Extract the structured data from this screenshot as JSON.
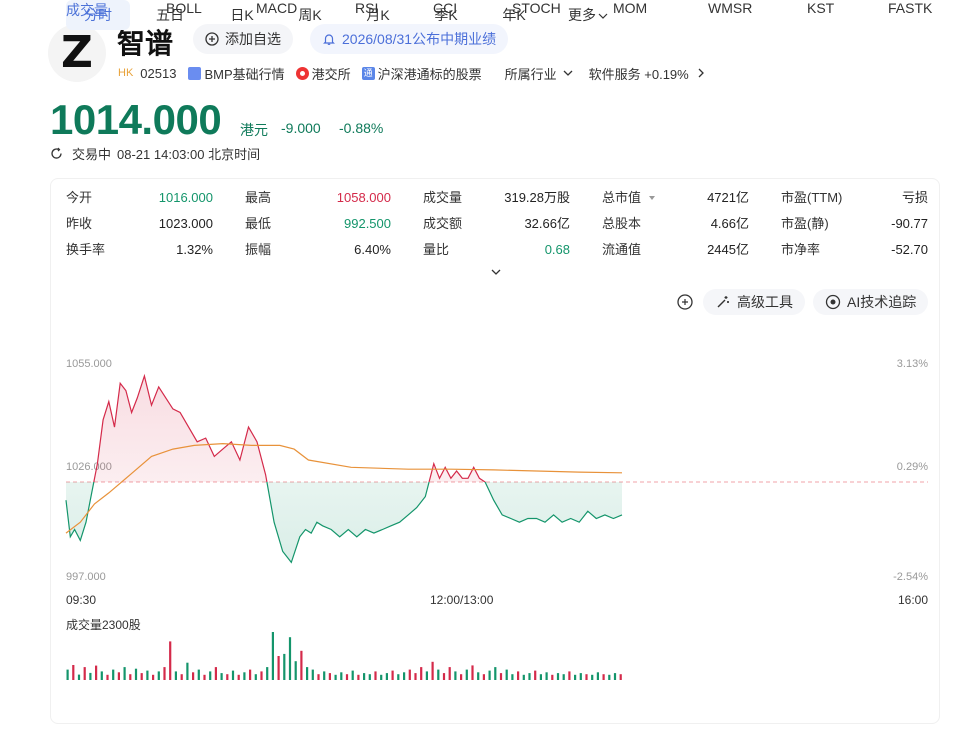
{
  "stock": {
    "logo_letter": "Z",
    "name": "智谱",
    "watch_label": "添加自选",
    "notice_label": "2026/08/31公布中期业绩"
  },
  "meta": {
    "market": "HK",
    "code": "02513",
    "bmp_label": "BMP基础行情",
    "exchange_label": "港交所",
    "connect_badge": "通",
    "connect_label": "沪深港通标的股票",
    "industry_label": "所属行业",
    "sector_label": "软件服务 +0.19%"
  },
  "quote": {
    "price": "1014.000",
    "currency": "港元",
    "change": "-9.000",
    "change_pct": "-0.88%",
    "status": "交易中",
    "time": "08-21 14:03:00 北京时间"
  },
  "stats": [
    {
      "label": "今开",
      "value": "1016.000",
      "color": "green"
    },
    {
      "label": "最高",
      "value": "1058.000",
      "color": "red"
    },
    {
      "label": "成交量",
      "value": "319.28万股",
      "color": "normal"
    },
    {
      "label": "总市值",
      "value": "4721亿",
      "color": "normal"
    },
    {
      "label": "市盈(TTM)",
      "value": "亏损",
      "color": "normal"
    },
    {
      "label": "昨收",
      "value": "1023.000",
      "color": "normal"
    },
    {
      "label": "最低",
      "value": "992.500",
      "color": "green"
    },
    {
      "label": "成交额",
      "value": "32.66亿",
      "color": "normal"
    },
    {
      "label": "总股本",
      "value": "4.66亿",
      "color": "normal"
    },
    {
      "label": "市盈(静)",
      "value": "-90.77",
      "color": "normal"
    },
    {
      "label": "换手率",
      "value": "1.32%",
      "color": "normal"
    },
    {
      "label": "振幅",
      "value": "6.40%",
      "color": "normal"
    },
    {
      "label": "量比",
      "value": "0.68",
      "color": "green"
    },
    {
      "label": "流通值",
      "value": "2445亿",
      "color": "normal"
    },
    {
      "label": "市净率",
      "value": "-52.70",
      "color": "normal"
    }
  ],
  "period_tabs": [
    "分时",
    "五日",
    "日K",
    "周K",
    "月K",
    "季K",
    "年K",
    "更多"
  ],
  "active_period": "分时",
  "tools": {
    "advanced": "高级工具",
    "ai": "AI技术追踪"
  },
  "chart_axes": {
    "y_top": "1055.000",
    "y_mid": "1026.000",
    "y_bottom": "997.000",
    "pct_top": "3.13%",
    "pct_mid": "0.29%",
    "pct_bottom": "-2.54%",
    "t_start": "09:30",
    "t_mid": "12:00/13:00",
    "t_end": "16:00"
  },
  "volume_title": "成交量2300股",
  "indicator_tabs": [
    "成交量",
    "BOLL",
    "MACD",
    "RSI",
    "CCI",
    "STOCH",
    "MOM",
    "WMSR",
    "KST",
    "FASTK"
  ],
  "active_indicator": "成交量",
  "colors": {
    "up": "#d42a4a",
    "down": "#14956b",
    "avg_line": "#e8923a",
    "accent": "#4c72d8"
  },
  "chart_data": {
    "type": "line",
    "title": "",
    "xlabel": "",
    "ylabel": "",
    "prev_close": 1023.0,
    "ylim": [
      997,
      1055
    ],
    "x_ticks": [
      "09:30",
      "12:00/13:00",
      "16:00"
    ],
    "x_range_minutes": [
      0,
      390
    ],
    "series": [
      {
        "name": "",
        "kind": "price",
        "x": [
          0,
          3,
          6,
          10,
          14,
          18,
          22,
          26,
          30,
          34,
          38,
          42,
          46,
          50,
          55,
          60,
          65,
          70,
          75,
          80,
          86,
          92,
          98,
          104,
          110,
          116,
          122,
          128,
          134,
          140,
          146,
          152,
          158,
          164,
          168,
          172,
          176,
          180,
          186,
          192,
          198,
          204,
          210,
          216,
          222,
          228,
          234,
          240,
          246,
          252,
          258,
          262,
          266,
          270,
          274,
          278,
          282,
          286,
          290,
          294,
          300,
          306,
          312,
          318,
          324,
          330,
          336,
          342,
          348,
          354,
          360,
          366,
          372,
          378,
          384,
          390
        ],
        "values": [
          1018,
          1008,
          1010,
          1007,
          1012,
          1020,
          1028,
          1040,
          1045,
          1038,
          1050,
          1048,
          1042,
          1046,
          1052,
          1044,
          1049,
          1046,
          1043,
          1042,
          1038,
          1034,
          1035,
          1030,
          1032,
          1034,
          1029,
          1038,
          1034,
          1025,
          1012,
          1004,
          1001,
          1008,
          1010,
          1009,
          1012,
          1011,
          1010,
          1008,
          1010,
          1008,
          1010,
          1009,
          1010,
          1011,
          1012,
          1014,
          1016,
          1019,
          1028,
          1024,
          1027,
          1024,
          1026,
          1024,
          1024,
          1027,
          1024,
          1023,
          1018,
          1014,
          1013,
          1012,
          1013,
          1013,
          1012,
          1014,
          1012,
          1013,
          1012,
          1015,
          1013,
          1014,
          1013,
          1014
        ]
      },
      {
        "name": "",
        "kind": "average",
        "x": [
          0,
          10,
          20,
          30,
          45,
          60,
          75,
          90,
          110,
          130,
          150,
          160,
          170,
          200,
          240,
          270,
          300,
          330,
          360,
          390
        ],
        "values": [
          1009,
          1012,
          1017,
          1020,
          1025,
          1030,
          1032,
          1033,
          1033.5,
          1033,
          1033,
          1032,
          1029,
          1027,
          1026.5,
          1026.5,
          1026.3,
          1026,
          1025.7,
          1025.5
        ]
      }
    ],
    "volume": {
      "name": "成交量",
      "max": 2300,
      "bars": [
        {
          "x": 0,
          "v": 500,
          "up": false
        },
        {
          "x": 4,
          "v": 720,
          "up": true
        },
        {
          "x": 8,
          "v": 260,
          "up": false
        },
        {
          "x": 12,
          "v": 620,
          "up": true
        },
        {
          "x": 16,
          "v": 340,
          "up": false
        },
        {
          "x": 20,
          "v": 690,
          "up": true
        },
        {
          "x": 24,
          "v": 410,
          "up": false
        },
        {
          "x": 28,
          "v": 250,
          "up": true
        },
        {
          "x": 32,
          "v": 500,
          "up": false
        },
        {
          "x": 36,
          "v": 370,
          "up": true
        },
        {
          "x": 40,
          "v": 620,
          "up": false
        },
        {
          "x": 44,
          "v": 280,
          "up": true
        },
        {
          "x": 48,
          "v": 540,
          "up": false
        },
        {
          "x": 52,
          "v": 330,
          "up": true
        },
        {
          "x": 56,
          "v": 450,
          "up": false
        },
        {
          "x": 60,
          "v": 250,
          "up": true
        },
        {
          "x": 64,
          "v": 410,
          "up": false
        },
        {
          "x": 68,
          "v": 620,
          "up": true
        },
        {
          "x": 72,
          "v": 1850,
          "up": true
        },
        {
          "x": 76,
          "v": 410,
          "up": false
        },
        {
          "x": 80,
          "v": 280,
          "up": true
        },
        {
          "x": 84,
          "v": 830,
          "up": false
        },
        {
          "x": 88,
          "v": 370,
          "up": true
        },
        {
          "x": 92,
          "v": 500,
          "up": false
        },
        {
          "x": 96,
          "v": 250,
          "up": true
        },
        {
          "x": 100,
          "v": 410,
          "up": false
        },
        {
          "x": 104,
          "v": 620,
          "up": true
        },
        {
          "x": 108,
          "v": 330,
          "up": false
        },
        {
          "x": 112,
          "v": 280,
          "up": true
        },
        {
          "x": 116,
          "v": 450,
          "up": false
        },
        {
          "x": 120,
          "v": 250,
          "up": true
        },
        {
          "x": 124,
          "v": 370,
          "up": false
        },
        {
          "x": 128,
          "v": 500,
          "up": true
        },
        {
          "x": 132,
          "v": 280,
          "up": false
        },
        {
          "x": 136,
          "v": 410,
          "up": true
        },
        {
          "x": 140,
          "v": 620,
          "up": false
        },
        {
          "x": 144,
          "v": 2300,
          "up": false
        },
        {
          "x": 148,
          "v": 1150,
          "up": true
        },
        {
          "x": 152,
          "v": 1250,
          "up": false
        },
        {
          "x": 156,
          "v": 2050,
          "up": false
        },
        {
          "x": 160,
          "v": 900,
          "up": false
        },
        {
          "x": 164,
          "v": 1400,
          "up": true
        },
        {
          "x": 168,
          "v": 620,
          "up": false
        },
        {
          "x": 172,
          "v": 500,
          "up": false
        },
        {
          "x": 176,
          "v": 280,
          "up": true
        },
        {
          "x": 180,
          "v": 410,
          "up": false
        },
        {
          "x": 184,
          "v": 330,
          "up": true
        },
        {
          "x": 188,
          "v": 250,
          "up": false
        },
        {
          "x": 192,
          "v": 370,
          "up": false
        },
        {
          "x": 196,
          "v": 280,
          "up": true
        },
        {
          "x": 200,
          "v": 450,
          "up": false
        },
        {
          "x": 204,
          "v": 250,
          "up": true
        },
        {
          "x": 208,
          "v": 330,
          "up": false
        },
        {
          "x": 212,
          "v": 280,
          "up": false
        },
        {
          "x": 216,
          "v": 410,
          "up": true
        },
        {
          "x": 220,
          "v": 250,
          "up": false
        },
        {
          "x": 224,
          "v": 330,
          "up": false
        },
        {
          "x": 228,
          "v": 450,
          "up": true
        },
        {
          "x": 232,
          "v": 280,
          "up": false
        },
        {
          "x": 236,
          "v": 370,
          "up": false
        },
        {
          "x": 240,
          "v": 500,
          "up": true
        },
        {
          "x": 244,
          "v": 330,
          "up": true
        },
        {
          "x": 248,
          "v": 620,
          "up": true
        },
        {
          "x": 252,
          "v": 410,
          "up": false
        },
        {
          "x": 256,
          "v": 870,
          "up": true
        },
        {
          "x": 260,
          "v": 500,
          "up": false
        },
        {
          "x": 264,
          "v": 330,
          "up": true
        },
        {
          "x": 268,
          "v": 620,
          "up": true
        },
        {
          "x": 272,
          "v": 410,
          "up": false
        },
        {
          "x": 276,
          "v": 280,
          "up": true
        },
        {
          "x": 280,
          "v": 500,
          "up": false
        },
        {
          "x": 284,
          "v": 700,
          "up": true
        },
        {
          "x": 288,
          "v": 370,
          "up": false
        },
        {
          "x": 292,
          "v": 280,
          "up": true
        },
        {
          "x": 296,
          "v": 450,
          "up": false
        },
        {
          "x": 300,
          "v": 620,
          "up": false
        },
        {
          "x": 304,
          "v": 330,
          "up": true
        },
        {
          "x": 308,
          "v": 500,
          "up": false
        },
        {
          "x": 312,
          "v": 280,
          "up": false
        },
        {
          "x": 316,
          "v": 410,
          "up": true
        },
        {
          "x": 320,
          "v": 250,
          "up": false
        },
        {
          "x": 324,
          "v": 330,
          "up": false
        },
        {
          "x": 328,
          "v": 450,
          "up": true
        },
        {
          "x": 332,
          "v": 280,
          "up": false
        },
        {
          "x": 336,
          "v": 370,
          "up": false
        },
        {
          "x": 340,
          "v": 250,
          "up": true
        },
        {
          "x": 344,
          "v": 330,
          "up": false
        },
        {
          "x": 348,
          "v": 280,
          "up": false
        },
        {
          "x": 352,
          "v": 410,
          "up": true
        },
        {
          "x": 356,
          "v": 250,
          "up": false
        },
        {
          "x": 360,
          "v": 330,
          "up": false
        },
        {
          "x": 364,
          "v": 280,
          "up": true
        },
        {
          "x": 368,
          "v": 250,
          "up": false
        },
        {
          "x": 372,
          "v": 370,
          "up": false
        },
        {
          "x": 376,
          "v": 280,
          "up": true
        },
        {
          "x": 380,
          "v": 250,
          "up": false
        },
        {
          "x": 384,
          "v": 330,
          "up": false
        },
        {
          "x": 388,
          "v": 280,
          "up": true
        }
      ]
    }
  }
}
